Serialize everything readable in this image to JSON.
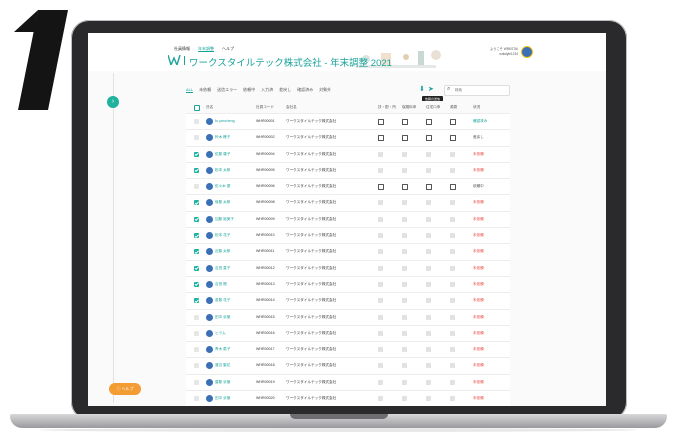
{
  "step_number": "1",
  "app": {
    "nav": [
      "社員情報",
      "年末調整",
      "ヘルプ"
    ],
    "nav_active": 1,
    "title": "ワークスタイルテック株式会社 - 年末調整 2021",
    "user_line1": "ようこそ WRKSTAI",
    "user_line2": "wrkstyle1234"
  },
  "filters": {
    "tabs": [
      "ALL",
      "未依頼",
      "送信エラー",
      "依頼中",
      "入力済",
      "差戻し",
      "確認済み",
      "対象外"
    ],
    "active": 0
  },
  "toolbar": {
    "download_icon": "download-icon",
    "send_icon": "send-icon",
    "tooltip": "依頼の送信",
    "search_placeholder": "検索"
  },
  "table": {
    "headers": [
      "",
      "氏名",
      "社員コード",
      "会社名",
      "扶・配・所",
      "保険料申",
      "住宅ロ申",
      "源泉",
      "状況"
    ],
    "rows": [
      {
        "checked": false,
        "name": "fu yancheng",
        "code": "WHR00001",
        "company": "ワークスタイルテック株式会社",
        "docs": [
          true,
          true,
          true,
          true
        ],
        "status": "確認済み",
        "status_color": "green"
      },
      {
        "checked": false,
        "name": "鈴木 穣子",
        "code": "WHR00002",
        "company": "ワークスタイルテック株式会社",
        "docs": [
          true,
          true,
          true,
          true
        ],
        "status": "差戻し",
        "status_color": "grey"
      },
      {
        "checked": true,
        "name": "佐藤 康子",
        "code": "WHR00004",
        "company": "ワークスタイルテック株式会社",
        "docs": [
          false,
          false,
          false,
          false
        ],
        "status": "未依頼",
        "status_color": "red"
      },
      {
        "checked": true,
        "name": "松本 太郎",
        "code": "WHR00005",
        "company": "ワークスタイルテック株式会社",
        "docs": [
          false,
          false,
          false,
          false
        ],
        "status": "未依頼",
        "status_color": "red"
      },
      {
        "checked": false,
        "name": "佐々木 優",
        "code": "WHR00006",
        "company": "ワークスタイルテック株式会社",
        "docs": [
          true,
          true,
          true,
          true
        ],
        "status": "依頼中",
        "status_color": "grey"
      },
      {
        "checked": true,
        "name": "後藤 太郎",
        "code": "WHR00008",
        "company": "ワークスタイルテック株式会社",
        "docs": [
          false,
          false,
          false,
          false
        ],
        "status": "未依頼",
        "status_color": "red"
      },
      {
        "checked": true,
        "name": "加藤 裕美子",
        "code": "WHR00009",
        "company": "ワークスタイルテック株式会社",
        "docs": [
          false,
          false,
          false,
          false
        ],
        "status": "未依頼",
        "status_color": "red"
      },
      {
        "checked": true,
        "name": "松本 花子",
        "code": "WHR00010",
        "company": "ワークスタイルテック株式会社",
        "docs": [
          false,
          false,
          false,
          false
        ],
        "status": "未依頼",
        "status_color": "red"
      },
      {
        "checked": true,
        "name": "近藤 太郎",
        "code": "WHR00011",
        "company": "ワークスタイルテック株式会社",
        "docs": [
          false,
          false,
          false,
          false
        ],
        "status": "未依頼",
        "status_color": "red"
      },
      {
        "checked": true,
        "name": "吉田 直子",
        "code": "WHR00012",
        "company": "ワークスタイルテック株式会社",
        "docs": [
          false,
          false,
          false,
          false
        ],
        "status": "未依頼",
        "status_color": "red"
      },
      {
        "checked": true,
        "name": "吉田 剛",
        "code": "WHR00013",
        "company": "ワークスタイルテック株式会社",
        "docs": [
          false,
          false,
          false,
          false
        ],
        "status": "未依頼",
        "status_color": "red"
      },
      {
        "checked": true,
        "name": "斎藤 花子",
        "code": "WHR00014",
        "company": "ワークスタイルテック株式会社",
        "docs": [
          false,
          false,
          false,
          false
        ],
        "status": "未依頼",
        "status_color": "red"
      },
      {
        "checked": false,
        "name": "田中 京極",
        "code": "WHR00015",
        "company": "ワークスタイルテック株式会社",
        "docs": [
          false,
          false,
          false,
          false
        ],
        "status": "未依頼",
        "status_color": "red"
      },
      {
        "checked": false,
        "name": "ヒラム",
        "code": "WHR00016",
        "company": "ワークスタイルテック株式会社",
        "docs": [
          false,
          false,
          false,
          false
        ],
        "status": "未依頼",
        "status_color": "red"
      },
      {
        "checked": false,
        "name": "青木 恵子",
        "code": "WHR00017",
        "company": "ワークスタイルテック株式会社",
        "docs": [
          false,
          false,
          false,
          false
        ],
        "status": "未依頼",
        "status_color": "red"
      },
      {
        "checked": false,
        "name": "渡辺 聖花",
        "code": "WHR00018",
        "company": "ワークスタイルテック株式会社",
        "docs": [
          false,
          false,
          false,
          false
        ],
        "status": "未依頼",
        "status_color": "red"
      },
      {
        "checked": false,
        "name": "齋藤 京極",
        "code": "WHR00019",
        "company": "ワークスタイルテック株式会社",
        "docs": [
          false,
          false,
          false,
          false
        ],
        "status": "未依頼",
        "status_color": "red"
      },
      {
        "checked": false,
        "name": "田中 京極",
        "code": "WHR00020",
        "company": "ワークスタイルテック株式会社",
        "docs": [
          false,
          false,
          false,
          false
        ],
        "status": "未依頼",
        "status_color": "red"
      }
    ]
  },
  "help_button": "ヘルプ",
  "expand_icon": "chevron-right-icon",
  "colors": {
    "accent": "#1aa39b",
    "checkbox": "#1fb29e",
    "help": "#f39c33",
    "alert": "#e74c3c"
  }
}
